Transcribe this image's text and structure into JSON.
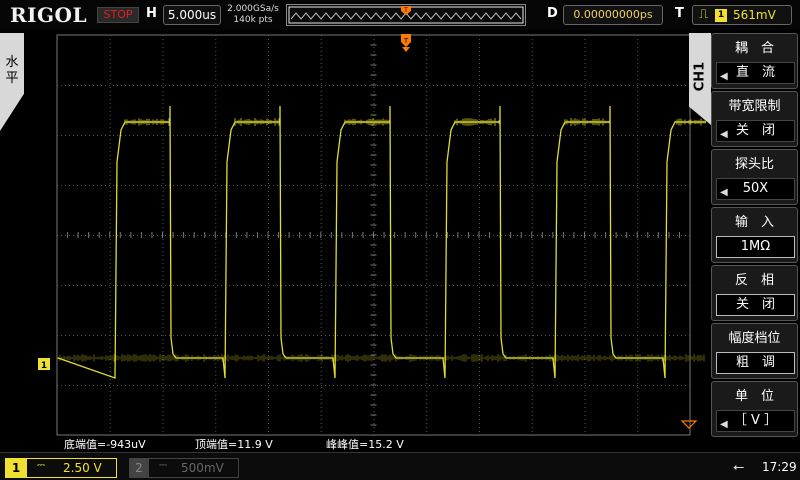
{
  "topbar": {
    "brand": "RIGOL",
    "run_state": "STOP",
    "h_label": "H",
    "timebase": "5.000us",
    "sample_rate": "2.000GSa/s",
    "memory_depth": "140k pts",
    "d_label": "D",
    "trigger_position": "0.00000000ps",
    "t_label": "T",
    "trigger_edge_icon": "rising-edge-icon",
    "trigger_source": "1",
    "trigger_level": "561mV"
  },
  "left_tab": {
    "label": "水平"
  },
  "channel_tab": {
    "label": "CH1"
  },
  "menu": [
    {
      "title": "耦　合",
      "value": "直　流",
      "has_arrow": true
    },
    {
      "title": "带宽限制",
      "value": "关　闭",
      "has_arrow": true
    },
    {
      "title": "探头比",
      "value": "50X",
      "has_arrow": true
    },
    {
      "title": "输　入",
      "value": "1MΩ",
      "has_arrow": false
    },
    {
      "title": "反　相",
      "value": "关　闭",
      "has_arrow": false
    },
    {
      "title": "幅度档位",
      "value": "粗　调",
      "has_arrow": false
    },
    {
      "title": "单　位",
      "value": "［ V ］",
      "has_arrow": true
    }
  ],
  "measurements": [
    {
      "text": "底端值=-943uV"
    },
    {
      "text": "顶端值=11.9 V"
    },
    {
      "text": "峰峰值=15.2 V"
    }
  ],
  "bottombar": {
    "ch1": {
      "number": "1",
      "coupling": "⎓",
      "scale": "2.50 V"
    },
    "ch2": {
      "number": "2",
      "coupling": "⎓",
      "scale": "500mV"
    },
    "usb_icon": "usb-icon",
    "time": "17:29"
  },
  "waveform": {
    "channel_marker": "1",
    "periods": 5.5,
    "duty_fraction": 0.5,
    "color": "#e0dc30"
  },
  "colors": {
    "ch1": "#f0e030",
    "trigger_marker": "#ff7a00",
    "stop": "#e02020",
    "grid": "#555555"
  }
}
